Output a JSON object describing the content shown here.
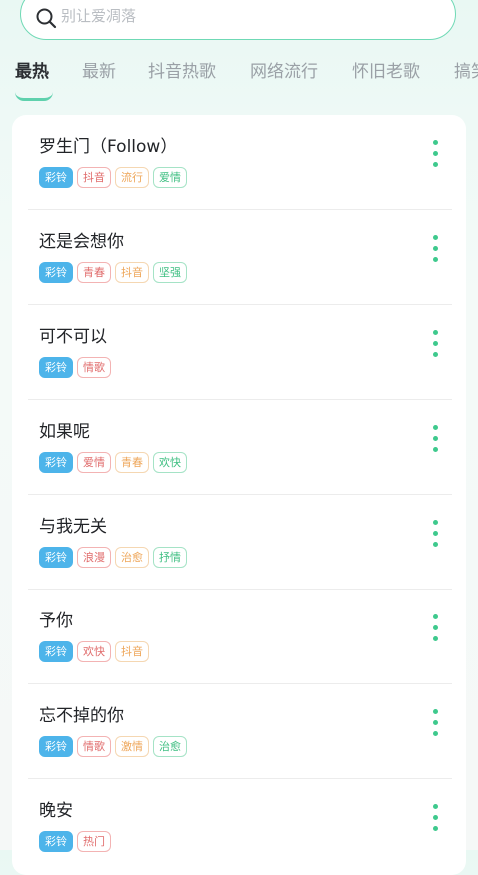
{
  "search": {
    "placeholder": "别让爱凋落"
  },
  "tabs": [
    {
      "label": "最热",
      "active": true
    },
    {
      "label": "最新"
    },
    {
      "label": "抖音热歌"
    },
    {
      "label": "网络流行"
    },
    {
      "label": "怀旧老歌"
    },
    {
      "label": "搞笑"
    }
  ],
  "songs": [
    {
      "title": "罗生门（Follow）",
      "tags": [
        {
          "label": "彩铃",
          "style": "primary"
        },
        {
          "label": "抖音",
          "style": "red"
        },
        {
          "label": "流行",
          "style": "orange"
        },
        {
          "label": "爱情",
          "style": "green"
        }
      ]
    },
    {
      "title": "还是会想你",
      "tags": [
        {
          "label": "彩铃",
          "style": "primary"
        },
        {
          "label": "青春",
          "style": "red"
        },
        {
          "label": "抖音",
          "style": "orange"
        },
        {
          "label": "坚强",
          "style": "green"
        }
      ]
    },
    {
      "title": "可不可以",
      "tags": [
        {
          "label": "彩铃",
          "style": "primary"
        },
        {
          "label": "情歌",
          "style": "red"
        }
      ]
    },
    {
      "title": "如果呢",
      "tags": [
        {
          "label": "彩铃",
          "style": "primary"
        },
        {
          "label": "爱情",
          "style": "red"
        },
        {
          "label": "青春",
          "style": "orange"
        },
        {
          "label": "欢快",
          "style": "green"
        }
      ]
    },
    {
      "title": "与我无关",
      "tags": [
        {
          "label": "彩铃",
          "style": "primary"
        },
        {
          "label": "浪漫",
          "style": "red"
        },
        {
          "label": "治愈",
          "style": "orange"
        },
        {
          "label": "抒情",
          "style": "green"
        }
      ]
    },
    {
      "title": "予你",
      "tags": [
        {
          "label": "彩铃",
          "style": "primary"
        },
        {
          "label": "欢快",
          "style": "red"
        },
        {
          "label": "抖音",
          "style": "orange"
        }
      ]
    },
    {
      "title": "忘不掉的你",
      "tags": [
        {
          "label": "彩铃",
          "style": "primary"
        },
        {
          "label": "情歌",
          "style": "red"
        },
        {
          "label": "激情",
          "style": "orange"
        },
        {
          "label": "治愈",
          "style": "green"
        }
      ]
    },
    {
      "title": "晚安",
      "tags": [
        {
          "label": "彩铃",
          "style": "primary"
        },
        {
          "label": "热门",
          "style": "red"
        }
      ]
    }
  ],
  "icons": {
    "search": "search-icon",
    "more": "more-vertical-icon"
  },
  "colors": {
    "accent": "#5fd1ad",
    "primary_tag": "#4db4ea",
    "more_dots": "#3ec98d"
  }
}
